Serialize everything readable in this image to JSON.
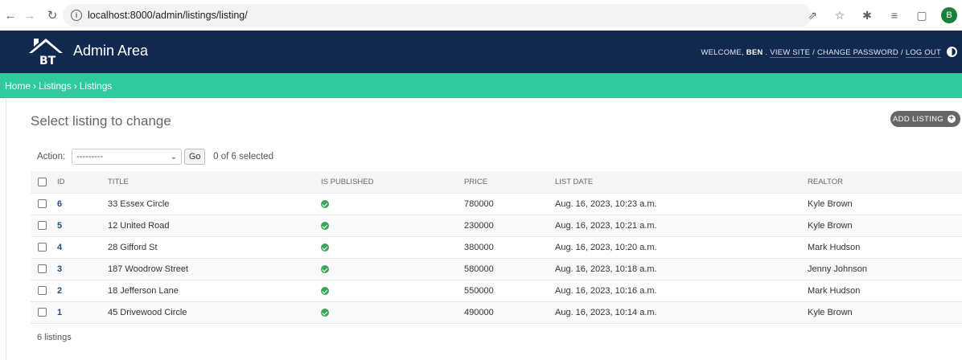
{
  "browser": {
    "url": "localhost:8000/admin/listings/listing/",
    "profile_initial": "B"
  },
  "header": {
    "site_name": "Admin Area",
    "logo_text": "BT",
    "welcome": "WELCOME,",
    "username": "BEN",
    "view_site": "VIEW SITE",
    "change_password": "CHANGE PASSWORD",
    "log_out": "LOG OUT",
    "separator": "/"
  },
  "breadcrumbs": {
    "items": [
      "Home",
      "Listings",
      "Listings"
    ],
    "sep": "›"
  },
  "content": {
    "title": "Select listing to change",
    "add_button": "ADD LISTING",
    "action_label": "Action:",
    "action_select": "---------",
    "go_button": "Go",
    "selected_counter": "0 of 6 selected",
    "paginator": "6 listings"
  },
  "table": {
    "headers": {
      "id": "ID",
      "title": "TITLE",
      "is_published": "IS PUBLISHED",
      "price": "PRICE",
      "list_date": "LIST DATE",
      "realtor": "REALTOR"
    },
    "rows": [
      {
        "id": "6",
        "title": "33 Essex Circle",
        "published": true,
        "price": "780000",
        "list_date": "Aug. 16, 2023, 10:23 a.m.",
        "realtor": "Kyle Brown"
      },
      {
        "id": "5",
        "title": "12 United Road",
        "published": true,
        "price": "230000",
        "list_date": "Aug. 16, 2023, 10:21 a.m.",
        "realtor": "Kyle Brown"
      },
      {
        "id": "4",
        "title": "28 Gifford St",
        "published": true,
        "price": "380000",
        "list_date": "Aug. 16, 2023, 10:20 a.m.",
        "realtor": "Mark Hudson"
      },
      {
        "id": "3",
        "title": "187 Woodrow Street",
        "published": true,
        "price": "580000",
        "list_date": "Aug. 16, 2023, 10:18 a.m.",
        "realtor": "Jenny Johnson"
      },
      {
        "id": "2",
        "title": "18 Jefferson Lane",
        "published": true,
        "price": "550000",
        "list_date": "Aug. 16, 2023, 10:16 a.m.",
        "realtor": "Mark Hudson"
      },
      {
        "id": "1",
        "title": "45 Drivewood Circle",
        "published": true,
        "price": "490000",
        "list_date": "Aug. 16, 2023, 10:14 a.m.",
        "realtor": "Kyle Brown"
      }
    ]
  },
  "colors": {
    "header_bg": "#12294f",
    "breadcrumb_bg": "#2fcb9e",
    "published_icon": "#3ba55c",
    "link": "#264b80"
  }
}
